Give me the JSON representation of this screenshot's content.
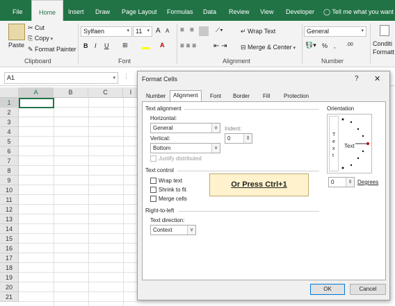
{
  "ribbon_tabs": [
    "File",
    "Home",
    "Insert",
    "Draw",
    "Page Layout",
    "Formulas",
    "Data",
    "Review",
    "View",
    "Developer"
  ],
  "tell_me": "Tell me what you want",
  "clipboard": {
    "paste": "Paste",
    "cut": "Cut",
    "copy": "Copy",
    "format_painter": "Format Painter",
    "group": "Clipboard"
  },
  "font": {
    "name": "Sylfaen",
    "size": "11",
    "bold": "B",
    "italic": "I",
    "underline": "U",
    "grow": "A",
    "shrink": "A",
    "group": "Font"
  },
  "alignment": {
    "wrap": "Wrap Text",
    "merge": "Merge & Center",
    "group": "Alignment"
  },
  "number": {
    "format": "General",
    "percent": "%",
    "comma": ",",
    "inc": ".00",
    "group": "Number"
  },
  "styles": {
    "conditional": "Conditi",
    "formatting": "Formatt"
  },
  "name_box": "A1",
  "columns": [
    "A",
    "B",
    "C",
    "I"
  ],
  "rows": [
    "1",
    "2",
    "3",
    "4",
    "5",
    "6",
    "7",
    "8",
    "9",
    "10",
    "11",
    "12",
    "13",
    "14",
    "15",
    "16",
    "17",
    "18",
    "19",
    "20",
    "21"
  ],
  "dialog": {
    "title": "Format Cells",
    "help": "?",
    "close": "✕",
    "tabs": [
      "Number",
      "Alignment",
      "Font",
      "Border",
      "Fill",
      "Protection"
    ],
    "text_alignment": "Text alignment",
    "horizontal_label": "Horizontal:",
    "horizontal_value": "General",
    "indent_label": "Indent:",
    "indent_value": "0",
    "vertical_label": "Vertical:",
    "vertical_value": "Bottom",
    "justify_distributed": "Justify distributed",
    "text_control": "Text control",
    "wrap_text": "Wrap text",
    "shrink_to_fit": "Shrink to fit",
    "merge_cells": "Merge cells",
    "rtl": "Right-to-left",
    "text_direction_label": "Text direction:",
    "text_direction_value": "Context",
    "orientation": "Orientation",
    "vertical_text": [
      "T",
      "e",
      "x",
      "t"
    ],
    "orient_text": "Text",
    "degrees_value": "0",
    "degrees_label": "Degrees",
    "ok": "OK",
    "cancel": "Cancel"
  },
  "callout": "Or Press Ctrl+1",
  "colors": {
    "excel_green": "#217346",
    "callout_bg": "#fff2cc",
    "callout_border": "#bfa96b"
  }
}
